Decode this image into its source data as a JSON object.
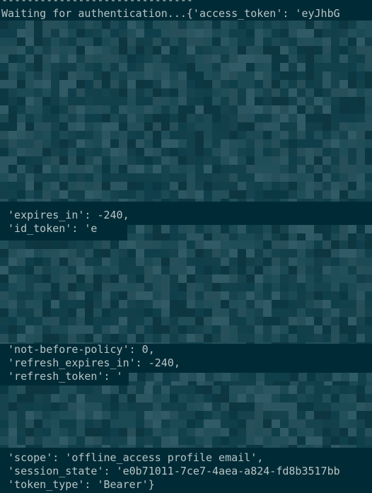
{
  "terminal": {
    "lines": {
      "separator": "------------------------------",
      "waiting": "Waiting for authentication...{'access_token': 'eyJhbG",
      "expires_in": " 'expires_in': -240,",
      "id_token": " 'id_token': 'e",
      "not_before_policy": " 'not-before-policy': 0,",
      "refresh_expires_in": " 'refresh_expires_in': -240,",
      "refresh_token": " 'refresh_token': '",
      "scope": " 'scope': 'offline_access profile email',",
      "session_state": " 'session_state': 'e0b71011-7ce7-4aea-a824-fd8b3517bb",
      "token_type": " 'token_type': 'Bearer'}"
    },
    "colors": {
      "background": "#002b36",
      "text": "#b8c4c6",
      "pixelation_palette": [
        "#0b3843",
        "#0f3f4b",
        "#133f4a",
        "#17434e",
        "#1b4954",
        "#1f4e59",
        "#234f5b",
        "#264f5a",
        "#2b5560",
        "#305a65",
        "#0e3641",
        "#12414c"
      ]
    }
  }
}
